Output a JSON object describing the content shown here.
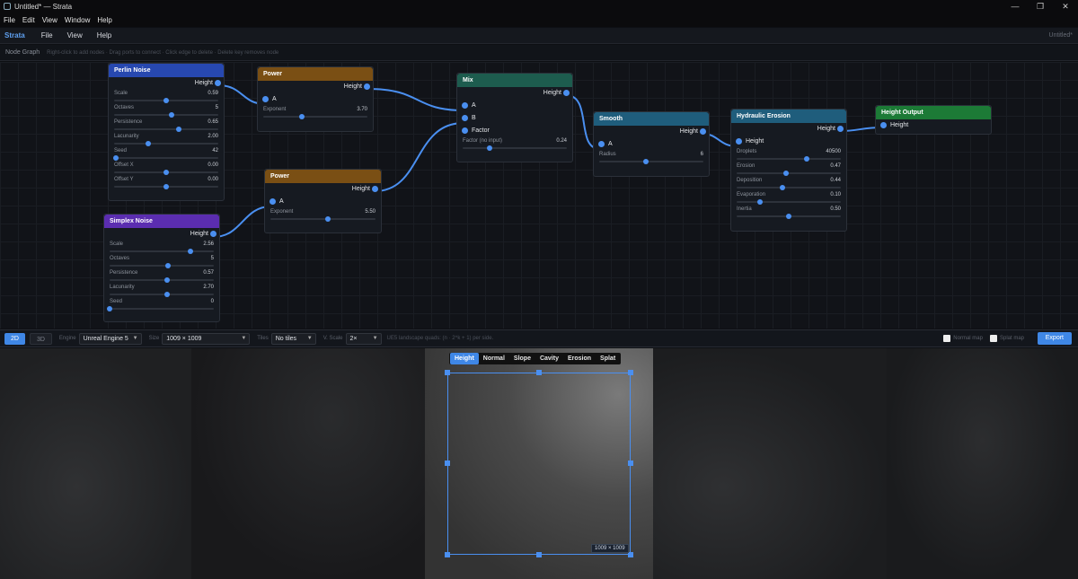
{
  "window": {
    "title": "Untitled* — Strata",
    "controls": [
      "—",
      "❐",
      "✕"
    ]
  },
  "os_menu": [
    "File",
    "Edit",
    "View",
    "Window",
    "Help"
  ],
  "app_menu": {
    "brand": "Strata",
    "items": [
      "File",
      "View",
      "Help"
    ],
    "document": "Untitled*"
  },
  "graph_bar": {
    "title": "Node Graph",
    "hint": "Right-click to add nodes · Drag ports to connect · Click edge to delete · Delete key removes node"
  },
  "nodes": {
    "perlin": {
      "title": "Perlin Noise",
      "color": "#2748b0",
      "output": "Height",
      "params": [
        {
          "label": "Scale",
          "value": "0.59",
          "pos": 0.5
        },
        {
          "label": "Octaves",
          "value": "5",
          "pos": 0.55
        },
        {
          "label": "Persistence",
          "value": "0.65",
          "pos": 0.62
        },
        {
          "label": "Lacunarity",
          "value": "2.00",
          "pos": 0.33
        },
        {
          "label": "Seed",
          "value": "42",
          "pos": 0.02
        },
        {
          "label": "Offset X",
          "value": "0.00",
          "pos": 0.5
        },
        {
          "label": "Offset Y",
          "value": "0.00",
          "pos": 0.5
        }
      ]
    },
    "power1": {
      "title": "Power",
      "color": "#7a4f14",
      "output": "Height",
      "input": "A",
      "params": [
        {
          "label": "Exponent",
          "value": "3.70",
          "pos": 0.37
        }
      ]
    },
    "power2": {
      "title": "Power",
      "color": "#7a4f14",
      "output": "Height",
      "input": "A",
      "params": [
        {
          "label": "Exponent",
          "value": "5.50",
          "pos": 0.55
        }
      ]
    },
    "simplex": {
      "title": "Simplex Noise",
      "color": "#5b2db0",
      "output": "Height",
      "params": [
        {
          "label": "Scale",
          "value": "2.56",
          "pos": 0.78
        },
        {
          "label": "Octaves",
          "value": "5",
          "pos": 0.56
        },
        {
          "label": "Persistence",
          "value": "0.57",
          "pos": 0.55
        },
        {
          "label": "Lacunarity",
          "value": "2.70",
          "pos": 0.55
        },
        {
          "label": "Seed",
          "value": "0",
          "pos": 0.0
        }
      ]
    },
    "mix": {
      "title": "Mix",
      "color": "#1d5c4e",
      "output": "Height",
      "inputs": [
        "A",
        "B",
        "Factor"
      ],
      "params": [
        {
          "label": "Factor (no input)",
          "value": "0.24",
          "pos": 0.26
        }
      ]
    },
    "smooth": {
      "title": "Smooth",
      "color": "#1f5d7c",
      "output": "Height",
      "input": "A",
      "params": [
        {
          "label": "Radius",
          "value": "6",
          "pos": 0.45
        }
      ]
    },
    "erosion": {
      "title": "Hydraulic Erosion",
      "color": "#1f5d7c",
      "output": "Height",
      "input": "Height",
      "params": [
        {
          "label": "Droplets",
          "value": "40500",
          "pos": 0.67
        },
        {
          "label": "Erosion",
          "value": "0.47",
          "pos": 0.47
        },
        {
          "label": "Deposition",
          "value": "0.44",
          "pos": 0.44
        },
        {
          "label": "Evaporation",
          "value": "0.10",
          "pos": 0.22
        },
        {
          "label": "Inertia",
          "value": "0.50",
          "pos": 0.5
        }
      ]
    },
    "output": {
      "title": "Height Output",
      "color": "#1c7a36",
      "input": "Height"
    }
  },
  "toolbar": {
    "mode_2d": "2D",
    "mode_3d": "3D",
    "engine_label": "Engine",
    "engine": "Unreal Engine 5",
    "size_label": "Size",
    "size": "1009 × 1009",
    "tiles_label": "Tiles",
    "tiles": "No tiles",
    "vscale_label": "V. Scale",
    "vscale": "2×",
    "hint": "UE5 landscape quads: (n · 2^k + 1) per side.",
    "normal_map": "Normal map",
    "splat_map": "Splat map",
    "export": "Export"
  },
  "preview": {
    "tabs": [
      "Height",
      "Normal",
      "Slope",
      "Cavity",
      "Erosion",
      "Splat"
    ],
    "active_tab": "Height",
    "dims": "1009 × 1009"
  }
}
